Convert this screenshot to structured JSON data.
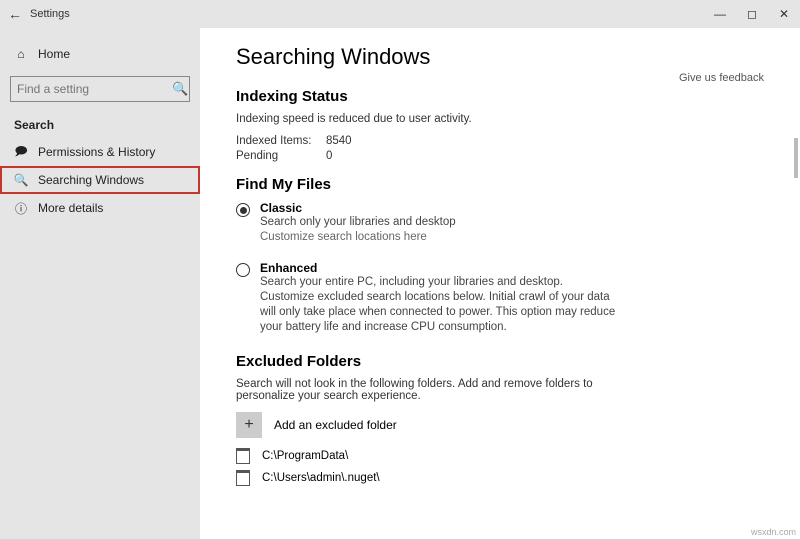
{
  "titlebar": {
    "title": "Settings"
  },
  "winbtns": {
    "min": "—",
    "max": "◻",
    "close": "✕"
  },
  "sidebar": {
    "home": "Home",
    "search_placeholder": "Find a setting",
    "section": "Search",
    "items": {
      "perm": "Permissions & History",
      "searching": "Searching Windows",
      "more": "More details"
    }
  },
  "main": {
    "feedback": "Give us feedback",
    "title": "Searching Windows",
    "status_heading": "Indexing Status",
    "status_text": "Indexing speed is reduced due to user activity.",
    "indexed_label": "Indexed Items:",
    "indexed_value": "8540",
    "pending_label": "Pending",
    "pending_value": "0",
    "find_heading": "Find My Files",
    "classic_title": "Classic",
    "classic_desc": "Search only your libraries and desktop",
    "classic_link": "Customize search locations here",
    "enhanced_title": "Enhanced",
    "enhanced_desc": "Search your entire PC, including your libraries and desktop. Customize excluded search locations below. Initial crawl of your data will only take place when connected to power. This option may reduce your battery life and increase CPU consumption.",
    "excluded_heading": "Excluded Folders",
    "excluded_text": "Search will not look in the following folders. Add and remove folders to personalize your search experience.",
    "add_label": "Add an excluded folder",
    "folders": {
      "f1": "C:\\ProgramData\\",
      "f2": "C:\\Users\\admin\\.nuget\\"
    }
  },
  "watermark": "wsxdn.com"
}
